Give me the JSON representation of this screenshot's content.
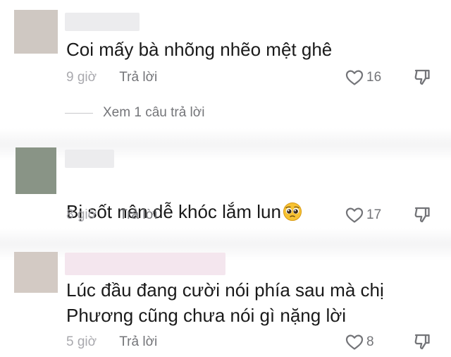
{
  "comments": [
    {
      "avatar_color": "#cfc8c2",
      "name_blur_color": "#ececee",
      "text": "Coi mấy bà nhõng nhẽo mệt ghê",
      "time": "9 giờ",
      "reply_label": "Trả lời",
      "likes": "16",
      "view_replies": "Xem 1 câu trả lời"
    },
    {
      "avatar_color": "#899486",
      "name_blur_color": "#ececee",
      "text": "Bị sốt nên dễ khóc lắm lun",
      "emoji": "pleading-face",
      "time": "8 giờ",
      "reply_label": "Trả lời",
      "likes": "17"
    },
    {
      "avatar_color": "#d3cac4",
      "name_blur_color": "#f4e6ee",
      "text": "Lúc đầu đang cười nói phía sau mà chị\nPhương cũng chưa nói gì nặng lời",
      "time": "5 giờ",
      "reply_label": "Trả lời",
      "likes": "8"
    }
  ],
  "icons": {
    "like": "heart-outline-icon",
    "dislike": "thumbs-down-icon"
  }
}
